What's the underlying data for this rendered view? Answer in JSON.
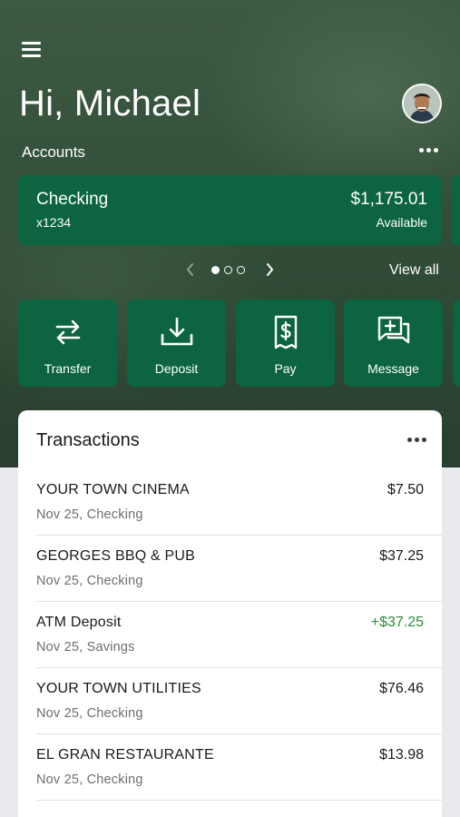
{
  "header": {
    "greeting": "Hi, Michael",
    "accounts_label": "Accounts"
  },
  "account_card": {
    "name": "Checking",
    "number": "x1234",
    "balance": "$1,175.01",
    "balance_label": "Available",
    "color": "#0c6540"
  },
  "pager": {
    "pages": 3,
    "current": 1,
    "view_all": "View all"
  },
  "actions": [
    {
      "label": "Transfer",
      "icon": "transfer-arrows-icon"
    },
    {
      "label": "Deposit",
      "icon": "deposit-tray-icon"
    },
    {
      "label": "Pay",
      "icon": "pay-bill-icon"
    },
    {
      "label": "Message",
      "icon": "message-plus-icon"
    }
  ],
  "transactions": {
    "title": "Transactions",
    "items": [
      {
        "description": "YOUR TOWN CINEMA",
        "meta": "Nov 25, Checking",
        "amount": "$7.50",
        "credit": false
      },
      {
        "description": "GEORGES BBQ & PUB",
        "meta": "Nov 25, Checking",
        "amount": "$37.25",
        "credit": false
      },
      {
        "description": "ATM Deposit",
        "meta": "Nov 25, Savings",
        "amount": "+$37.25",
        "credit": true
      },
      {
        "description": "YOUR TOWN UTILITIES",
        "meta": "Nov 25, Checking",
        "amount": "$76.46",
        "credit": false
      },
      {
        "description": "EL GRAN RESTAURANTE",
        "meta": "Nov 25, Checking",
        "amount": "$13.98",
        "credit": false
      }
    ]
  },
  "colors": {
    "brand_green": "#0c6540",
    "credit_green": "#2e8b3e",
    "background": "#e8eaed"
  }
}
